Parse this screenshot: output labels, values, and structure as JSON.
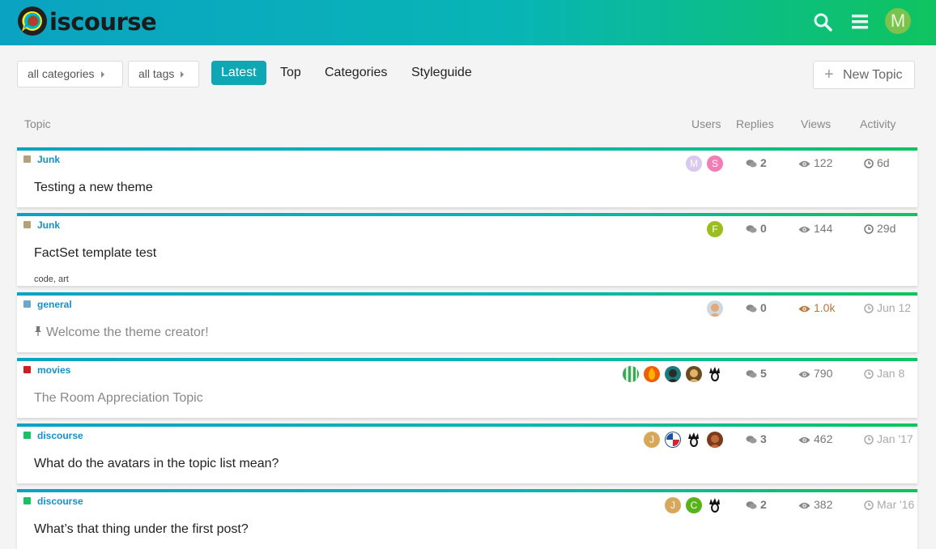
{
  "header": {
    "logo_text": "iscourse",
    "avatar_letter": "M",
    "colors": {
      "gradient_start": "#0aa3c2",
      "gradient_end": "#0fc45f"
    }
  },
  "nav": {
    "categories_dropdown": "all categories",
    "tags_dropdown": "all tags",
    "tabs": [
      "Latest",
      "Top",
      "Categories",
      "Styleguide"
    ],
    "new_topic": "New Topic"
  },
  "columns": {
    "topic": "Topic",
    "users": "Users",
    "replies": "Replies",
    "views": "Views",
    "activity": "Activity"
  },
  "topics": [
    {
      "category": "Junk",
      "category_color": "#b3a17a",
      "title": "Testing a new theme",
      "tags": "",
      "avatars": [
        "M",
        "S"
      ],
      "replies": "2",
      "views": "122",
      "activity": "6d"
    },
    {
      "category": "Junk",
      "category_color": "#b3a17a",
      "title": "FactSet template test",
      "tags": "code, art",
      "avatars": [
        "F"
      ],
      "replies": "0",
      "views": "144",
      "activity": "29d"
    },
    {
      "category": "general",
      "category_color": "#6ea6cc",
      "title": "Welcome the theme creator!",
      "tags": "",
      "avatars": [
        ""
      ],
      "replies": "0",
      "views": "1.0k",
      "activity": "Jun 12"
    },
    {
      "category": "movies",
      "category_color": "#cc1f1f",
      "title": "The Room Appreciation Topic",
      "tags": "",
      "avatars": [
        "",
        "",
        "",
        "",
        ""
      ],
      "replies": "5",
      "views": "790",
      "activity": "Jan 8"
    },
    {
      "category": "discourse",
      "category_color": "#15c264",
      "title": "What do the avatars in the topic list mean?",
      "tags": "",
      "avatars": [
        "J",
        "",
        "",
        ""
      ],
      "replies": "3",
      "views": "462",
      "activity": "Jan '17"
    },
    {
      "category": "discourse",
      "category_color": "#15c264",
      "title": "What’s that thing under the first post?",
      "tags": "",
      "avatars": [
        "J",
        "C",
        ""
      ],
      "replies": "2",
      "views": "382",
      "activity": "Mar '16"
    }
  ]
}
